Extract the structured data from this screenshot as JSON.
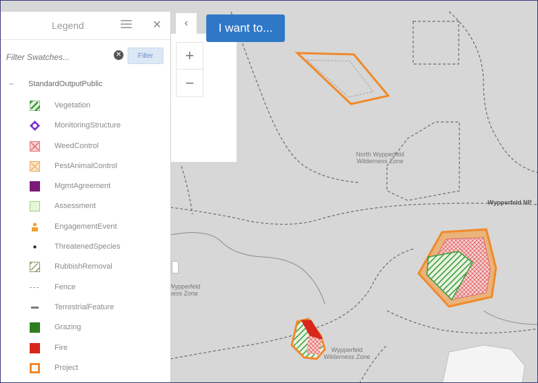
{
  "legend": {
    "title": "Legend",
    "filter_placeholder": "Filter Swatches...",
    "filter_button": "Filter",
    "group_label": "StandardOutputPublic",
    "collapse_symbol": "−",
    "items": [
      {
        "label": "Vegetation",
        "icon": "vegetation-swatch-icon"
      },
      {
        "label": "MonitoringStructure",
        "icon": "monitoring-structure-icon"
      },
      {
        "label": "WeedControl",
        "icon": "weed-control-swatch-icon"
      },
      {
        "label": "PestAnimalControl",
        "icon": "pest-animal-control-swatch-icon"
      },
      {
        "label": "MgmtAgreement",
        "icon": "mgmt-agreement-swatch-icon"
      },
      {
        "label": "Assessment",
        "icon": "assessment-swatch-icon"
      },
      {
        "label": "EngagementEvent",
        "icon": "engagement-event-icon"
      },
      {
        "label": "ThreatenedSpecies",
        "icon": "threatened-species-icon"
      },
      {
        "label": "RubbishRemoval",
        "icon": "rubbish-removal-swatch-icon"
      },
      {
        "label": "Fence",
        "icon": "fence-line-icon"
      },
      {
        "label": "TerrestrialFeature",
        "icon": "terrestrial-feature-icon"
      },
      {
        "label": "Grazing",
        "icon": "grazing-swatch-icon"
      },
      {
        "label": "Fire",
        "icon": "fire-swatch-icon"
      },
      {
        "label": "Project",
        "icon": "project-swatch-icon"
      }
    ]
  },
  "map": {
    "want_to_button": "I want to...",
    "zoom_in": "+",
    "zoom_out": "−",
    "collapse_arrow": "‹",
    "labels": {
      "north_wilderness": [
        "North Wypperfeld",
        "Wilderness Zone"
      ],
      "wypperfeld_np": "Wypperfeld NP",
      "west_zone": [
        "Wypperfeld",
        "ness Zone"
      ],
      "south_zone": [
        "Wypperfeld",
        "Wilderness Zone"
      ]
    }
  },
  "colors": {
    "accent": "#2f78c8",
    "project_outline": "#f0892a",
    "fire": "#d9261c",
    "grazing": "#2e7d1f",
    "weed_control": "#e36a6a",
    "vegetation": "#3a9a3a",
    "mgmt_agreement": "#7a1a7a"
  }
}
